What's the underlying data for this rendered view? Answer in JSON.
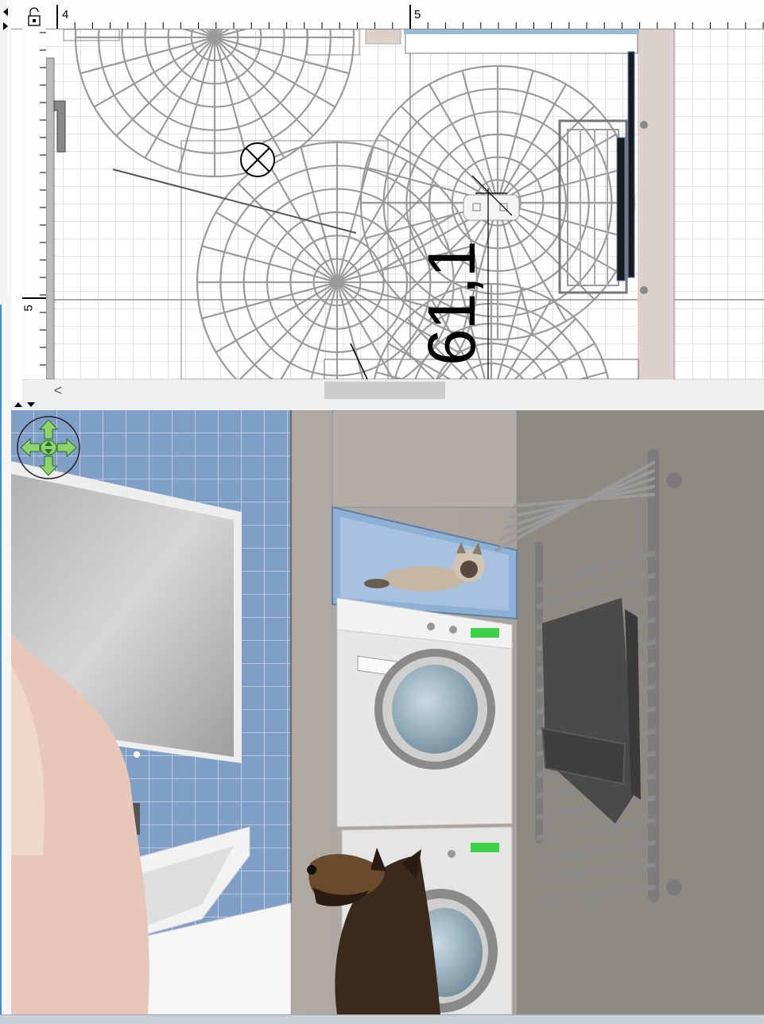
{
  "plan": {
    "ruler_top_labels": [
      "4",
      "5"
    ],
    "ruler_left_labels": [
      "5"
    ],
    "dimension_label": "61,1"
  },
  "scrollbar": {
    "left_arrow": "<"
  },
  "colors": {
    "wall_beige": "#ddd2cb",
    "tile_blue": "#7f9fc7",
    "wall_grey": "#8d8983",
    "nav_green": "#8fd46a"
  },
  "icons": {
    "lock": "lock-icon",
    "navigator": "navigation-compass-icon",
    "left_arrow": "chevron-left-icon"
  }
}
